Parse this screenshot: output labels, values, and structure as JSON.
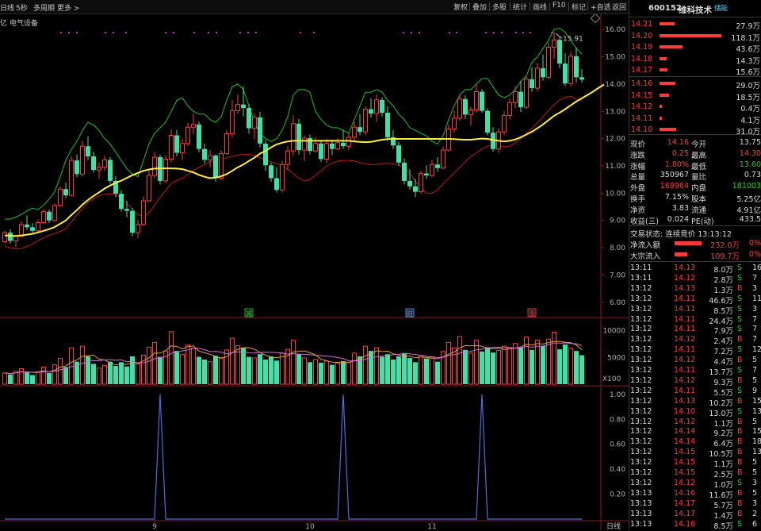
{
  "toolbar": {
    "left": [
      "日线",
      "5秒",
      "多周期",
      "更多 >"
    ],
    "right": [
      "复权",
      "叠加",
      "多股",
      "统计",
      "画线",
      "F10",
      "标记",
      "+自选",
      "返回"
    ]
  },
  "chart_info": {
    "sector": "亿 电气设备",
    "max_label": "15.91",
    "period_label": "日线",
    "vol_unit": "X100"
  },
  "price_axis": [
    "16.00",
    "15.00",
    "14.00",
    "13.00",
    "12.00",
    "11.00",
    "10.00",
    "9.00",
    "8.00",
    "7.00",
    "6.00"
  ],
  "vol_axis": [
    "10000",
    "5000"
  ],
  "ind_axis": [
    "1.00",
    "0.80",
    "0.60",
    "0.40",
    "0.20"
  ],
  "date_labels": [
    "9",
    "10",
    "11"
  ],
  "markers": [
    "减",
    "财",
    "涨"
  ],
  "colors": {
    "up": "#ff3b3b",
    "down": "#40e0a8",
    "ma": "#ffee33",
    "upper": "#22c022",
    "lower": "#c01818",
    "indicator": "#4a6fe0",
    "bg": "#000000"
  },
  "chart_data": {
    "type": "candlestick",
    "ylim": [
      5.5,
      16.5
    ],
    "candles": [
      [
        8.22,
        8.62,
        8.18,
        8.55
      ],
      [
        8.55,
        8.68,
        8.15,
        8.25
      ],
      [
        8.25,
        8.48,
        8.02,
        8.42
      ],
      [
        8.42,
        8.98,
        8.38,
        8.85
      ],
      [
        8.85,
        9.18,
        8.65,
        8.75
      ],
      [
        8.75,
        8.9,
        8.55,
        8.62
      ],
      [
        8.62,
        9.02,
        8.58,
        8.92
      ],
      [
        8.92,
        9.42,
        8.88,
        9.32
      ],
      [
        9.32,
        9.4,
        8.9,
        9.0
      ],
      [
        9.0,
        9.62,
        8.95,
        9.55
      ],
      [
        9.55,
        10.25,
        9.48,
        10.15
      ],
      [
        10.15,
        10.38,
        9.82,
        9.92
      ],
      [
        9.92,
        11.35,
        9.88,
        11.2
      ],
      [
        11.2,
        11.42,
        10.58,
        10.7
      ],
      [
        10.7,
        11.92,
        10.62,
        11.72
      ],
      [
        11.72,
        12.08,
        11.22,
        11.35
      ],
      [
        11.35,
        11.52,
        10.75,
        10.85
      ],
      [
        10.85,
        11.12,
        10.52,
        10.95
      ],
      [
        10.95,
        11.38,
        10.82,
        11.22
      ],
      [
        11.22,
        11.32,
        10.35,
        10.45
      ],
      [
        10.45,
        10.62,
        9.85,
        9.98
      ],
      [
        9.98,
        10.12,
        9.32,
        9.42
      ],
      [
        9.42,
        9.72,
        9.12,
        9.35
      ],
      [
        9.35,
        9.46,
        8.42,
        8.55
      ],
      [
        8.55,
        9.02,
        8.35,
        8.85
      ],
      [
        8.85,
        9.88,
        8.8,
        9.72
      ],
      [
        9.72,
        10.82,
        9.66,
        10.65
      ],
      [
        10.65,
        11.52,
        10.55,
        11.32
      ],
      [
        11.32,
        11.42,
        10.32,
        10.45
      ],
      [
        10.45,
        11.4,
        10.38,
        11.25
      ],
      [
        11.25,
        12.35,
        11.12,
        12.12
      ],
      [
        12.12,
        12.32,
        11.35,
        11.48
      ],
      [
        11.48,
        11.98,
        11.22,
        11.82
      ],
      [
        11.82,
        12.58,
        11.72,
        12.42
      ],
      [
        12.42,
        12.92,
        12.18,
        12.52
      ],
      [
        12.52,
        12.62,
        11.5,
        11.62
      ],
      [
        11.62,
        11.82,
        11.08,
        11.22
      ],
      [
        11.22,
        11.58,
        10.95,
        11.38
      ],
      [
        11.38,
        11.42,
        10.42,
        10.55
      ],
      [
        10.55,
        11.58,
        10.48,
        11.45
      ],
      [
        11.45,
        12.32,
        11.42,
        12.18
      ],
      [
        12.18,
        13.42,
        12.05,
        13.02
      ],
      [
        13.02,
        13.62,
        12.92,
        13.25
      ],
      [
        13.25,
        13.92,
        12.82,
        13.12
      ],
      [
        13.12,
        13.25,
        12.18,
        12.38
      ],
      [
        12.38,
        12.92,
        11.98,
        12.78
      ],
      [
        12.78,
        12.98,
        11.68,
        11.82
      ],
      [
        11.82,
        11.95,
        10.82,
        11.02
      ],
      [
        11.02,
        11.12,
        10.42,
        10.55
      ],
      [
        10.55,
        10.95,
        10.02,
        10.12
      ],
      [
        10.12,
        11.18,
        10.02,
        11.05
      ],
      [
        11.05,
        11.72,
        10.85,
        11.55
      ],
      [
        11.55,
        12.85,
        11.38,
        12.55
      ],
      [
        12.55,
        12.72,
        11.42,
        11.58
      ],
      [
        11.58,
        12.12,
        11.18,
        12.02
      ],
      [
        12.02,
        12.15,
        11.42,
        11.55
      ],
      [
        11.55,
        12.05,
        11.5,
        11.82
      ],
      [
        11.82,
        11.95,
        11.15,
        11.25
      ],
      [
        11.25,
        12.0,
        11.1,
        11.82
      ],
      [
        11.82,
        11.96,
        11.4,
        11.62
      ],
      [
        11.62,
        12.02,
        11.58,
        11.85
      ],
      [
        11.85,
        12.32,
        11.62,
        11.72
      ],
      [
        11.72,
        12.18,
        11.58,
        12.05
      ],
      [
        12.05,
        12.62,
        11.88,
        12.42
      ],
      [
        12.42,
        12.9,
        12.12,
        12.25
      ],
      [
        12.25,
        13.18,
        12.12,
        13.08
      ],
      [
        13.08,
        13.48,
        12.78,
        12.92
      ],
      [
        12.92,
        13.62,
        12.62,
        13.42
      ],
      [
        13.42,
        13.52,
        12.82,
        12.95
      ],
      [
        12.95,
        13.18,
        11.92,
        12.05
      ],
      [
        12.05,
        12.32,
        11.62,
        11.75
      ],
      [
        11.75,
        11.88,
        11.0,
        11.12
      ],
      [
        11.12,
        11.28,
        10.32,
        10.45
      ],
      [
        10.45,
        10.88,
        10.12,
        10.25
      ],
      [
        10.25,
        10.52,
        9.86,
        10.05
      ],
      [
        10.05,
        10.82,
        9.98,
        10.72
      ],
      [
        10.72,
        11.02,
        10.52,
        10.65
      ],
      [
        10.65,
        11.22,
        10.58,
        11.05
      ],
      [
        11.05,
        11.32,
        10.78,
        10.92
      ],
      [
        10.92,
        11.72,
        10.88,
        11.58
      ],
      [
        11.58,
        12.52,
        11.52,
        12.35
      ],
      [
        12.35,
        13.02,
        12.22,
        12.75
      ],
      [
        12.75,
        13.62,
        12.65,
        13.45
      ],
      [
        13.45,
        13.58,
        12.72,
        12.88
      ],
      [
        12.88,
        13.18,
        12.48,
        13.05
      ],
      [
        13.05,
        14.02,
        12.95,
        13.72
      ],
      [
        13.72,
        13.82,
        12.95,
        13.02
      ],
      [
        13.02,
        13.12,
        12.12,
        12.22
      ],
      [
        12.22,
        12.42,
        11.52,
        11.62
      ],
      [
        11.62,
        12.38,
        11.48,
        12.25
      ],
      [
        12.25,
        13.02,
        12.12,
        12.85
      ],
      [
        12.85,
        13.48,
        12.72,
        13.32
      ],
      [
        13.32,
        13.92,
        13.12,
        13.72
      ],
      [
        13.72,
        14.12,
        12.98,
        13.15
      ],
      [
        13.15,
        14.32,
        13.08,
        14.18
      ],
      [
        14.18,
        14.62,
        13.72,
        13.85
      ],
      [
        13.85,
        14.78,
        13.72,
        14.58
      ],
      [
        14.58,
        15.08,
        14.12,
        14.25
      ],
      [
        14.25,
        15.52,
        14.18,
        15.35
      ],
      [
        15.35,
        15.91,
        14.92,
        15.62
      ],
      [
        15.62,
        15.72,
        14.58,
        14.75
      ],
      [
        14.75,
        15.12,
        13.92,
        14.02
      ],
      [
        14.02,
        15.18,
        13.92,
        15.02
      ],
      [
        15.02,
        15.35,
        14.05,
        14.25
      ],
      [
        14.25,
        14.55,
        14.05,
        14.16
      ]
    ],
    "volume": [
      2100,
      1800,
      2400,
      2900,
      2200,
      1700,
      2300,
      3200,
      2100,
      3600,
      4800,
      3200,
      6800,
      4200,
      7100,
      5200,
      3800,
      3000,
      3500,
      4200,
      3400,
      4100,
      3300,
      5200,
      3800,
      5400,
      6900,
      7800,
      5100,
      6200,
      9800,
      6200,
      5600,
      7300,
      6700,
      5100,
      4600,
      4200,
      5300,
      5000,
      6400,
      8600,
      7200,
      6800,
      5100,
      4900,
      5600,
      4600,
      5200,
      4400,
      5800,
      6500,
      8200,
      5600,
      4900,
      4100,
      4600,
      4000,
      4300,
      3600,
      3900,
      4300,
      4100,
      5800,
      5200,
      7100,
      6200,
      6800,
      5100,
      5600,
      4600,
      5200,
      5800,
      4900,
      4100,
      5400,
      4800,
      5100,
      4200,
      6100,
      7800,
      6800,
      8900,
      6400,
      5800,
      8200,
      6100,
      6900,
      5900,
      6300,
      7100,
      6800,
      7600,
      6900,
      8800,
      6400,
      8200,
      7100,
      8400,
      9700,
      6500,
      7400,
      6700,
      6200,
      5400
    ],
    "ma": [
      8.45,
      8.44,
      8.43,
      8.45,
      8.48,
      8.51,
      8.56,
      8.62,
      8.68,
      8.76,
      8.88,
      9.0,
      9.2,
      9.38,
      9.58,
      9.75,
      9.9,
      10.03,
      10.17,
      10.28,
      10.38,
      10.46,
      10.56,
      10.66,
      10.74,
      10.82,
      10.87,
      10.9,
      10.91,
      10.91,
      10.91,
      10.9,
      10.88,
      10.82,
      10.76,
      10.67,
      10.6,
      10.55,
      10.57,
      10.62,
      10.7,
      10.82,
      10.95,
      11.05,
      11.18,
      11.3,
      11.45,
      11.55,
      11.68,
      11.79,
      11.85,
      11.9,
      11.92,
      11.92,
      11.92,
      11.92,
      11.92,
      11.92,
      11.92,
      11.92,
      11.92,
      11.92,
      11.92,
      11.9,
      11.88,
      11.87,
      11.88,
      11.92,
      11.96,
      11.98,
      11.99,
      11.99,
      11.99,
      11.99,
      11.99,
      11.99,
      11.99,
      11.99,
      11.99,
      11.99,
      11.99,
      11.98,
      11.97,
      11.96,
      11.96,
      11.98,
      12.0,
      11.99,
      11.95,
      11.92,
      11.9,
      11.92,
      11.97,
      12.05,
      12.15,
      12.25,
      12.38,
      12.52,
      12.68,
      12.84,
      12.95,
      13.08,
      13.22,
      13.36,
      13.48,
      13.6,
      13.72,
      13.86,
      13.98
    ],
    "upper": [
      9.05,
      9.05,
      9.12,
      9.22,
      9.35,
      9.45,
      9.4,
      9.55,
      9.78,
      10.05,
      10.6,
      11.2,
      11.6,
      11.9,
      12.3,
      12.6,
      12.5,
      12.3,
      12.0,
      11.8,
      11.5,
      11.2,
      10.9,
      10.7,
      10.6,
      11.2,
      11.8,
      12.2,
      12.4,
      12.6,
      13.0,
      13.4,
      13.5,
      13.2,
      13.0,
      12.9,
      12.9,
      12.7,
      12.6,
      12.8,
      13.4,
      13.9,
      14.0,
      13.8,
      13.2,
      12.6,
      12.2,
      12.0,
      11.9,
      12.0,
      12.3,
      12.8,
      13.6,
      13.8,
      13.8,
      13.7,
      13.0,
      12.7,
      12.5,
      12.4,
      12.4,
      12.3,
      12.2,
      12.7,
      13.2,
      13.7,
      13.7,
      13.8,
      13.7,
      13.4,
      13.2,
      12.9,
      12.7,
      12.4,
      12.3,
      12.2,
      12.1,
      11.9,
      11.8,
      12.1,
      12.7,
      13.2,
      13.6,
      13.8,
      13.8,
      14.0,
      14.2,
      14.2,
      13.9,
      13.6,
      13.5,
      13.6,
      13.8,
      14.1,
      14.3,
      14.8,
      15.0,
      15.3,
      15.6,
      16.0,
      16.05,
      15.9,
      15.6,
      15.3,
      15.1
    ],
    "lower": [
      8.05,
      8.0,
      7.96,
      7.97,
      8.05,
      8.14,
      8.25,
      8.37,
      8.46,
      8.52,
      8.6,
      8.7,
      8.95,
      9.2,
      9.45,
      9.65,
      9.8,
      9.9,
      9.96,
      9.98,
      9.95,
      9.82,
      9.62,
      9.42,
      9.22,
      9.15,
      9.28,
      9.55,
      9.85,
      10.1,
      10.35,
      10.48,
      10.55,
      10.68,
      10.82,
      10.95,
      11.05,
      11.15,
      11.2,
      11.25,
      11.3,
      11.35,
      11.4,
      11.42,
      11.42,
      11.38,
      11.3,
      11.22,
      11.15,
      11.08,
      11.0,
      10.88,
      10.72,
      10.55,
      10.45,
      10.5,
      10.65,
      10.82,
      11.0,
      11.1,
      11.18,
      11.2,
      11.2,
      11.18,
      11.12,
      11.08,
      11.05,
      11.05,
      11.08,
      11.1,
      11.08,
      11.02,
      10.92,
      10.72,
      10.45,
      10.2,
      10.0,
      10.0,
      10.12,
      10.35,
      10.55,
      10.75,
      10.95,
      11.15,
      11.35,
      11.48,
      11.62,
      11.72,
      11.78,
      11.75,
      11.7,
      11.72,
      11.85,
      12.0,
      12.18,
      12.38,
      12.58,
      12.8,
      13.02,
      13.25,
      13.42,
      13.52,
      13.55,
      13.45,
      13.4
    ],
    "indicator": {
      "ylim": [
        0,
        1.05
      ],
      "peaks_at": [
        28,
        61,
        86
      ]
    }
  },
  "stock": {
    "code": "600152",
    "name": "维科技术",
    "tag": "储能"
  },
  "asks": [
    {
      "label": "14.21",
      "vol": "27.9万",
      "bar": 0.24
    },
    {
      "label": "14.20",
      "vol": "118.1万",
      "bar": 1.0
    },
    {
      "label": "14.19",
      "vol": "43.6万",
      "bar": 0.37
    },
    {
      "label": "14.18",
      "vol": "14.3万",
      "bar": 0.12
    },
    {
      "label": "14.17",
      "vol": "15.6万",
      "bar": 0.13
    }
  ],
  "bids": [
    {
      "label": "14.16",
      "vol": "29.0万",
      "bar": 0.25
    },
    {
      "label": "14.15",
      "vol": "18.5万",
      "bar": 0.16
    },
    {
      "label": "14.12",
      "vol": "0.4万",
      "bar": 0.02
    },
    {
      "label": "14.11",
      "vol": "4.1万",
      "bar": 0.04
    },
    {
      "label": "14.10",
      "vol": "31.0万",
      "bar": 0.27
    }
  ],
  "stats": [
    {
      "l1": "现价",
      "v1": "14.16",
      "c1": "red",
      "l2": "今开",
      "v2": "13.75",
      "c2": "white"
    },
    {
      "l1": "涨跌",
      "v1": "0.25",
      "c1": "red",
      "l2": "最高",
      "v2": "14.30",
      "c2": "red"
    },
    {
      "l1": "涨幅",
      "v1": "1.80%",
      "c1": "red",
      "l2": "最低",
      "v2": "13.60",
      "c2": "green"
    },
    {
      "l1": "总量",
      "v1": "350967",
      "c1": "white",
      "l2": "量比",
      "v2": "0.73",
      "c2": "white"
    },
    {
      "l1": "外盘",
      "v1": "169964",
      "c1": "red",
      "l2": "内盘",
      "v2": "181003",
      "c2": "green"
    },
    {
      "l1": "换手",
      "v1": "7.15%",
      "c1": "white",
      "l2": "股本",
      "v2": "5.25亿",
      "c2": "white"
    },
    {
      "l1": "净资",
      "v1": "3.83",
      "c1": "white",
      "l2": "流通",
      "v2": "4.91亿",
      "c2": "white"
    },
    {
      "l1": "收益(三)",
      "v1": "0.024",
      "c1": "white",
      "l2": "PE(动)",
      "v2": "433.5",
      "c2": "white"
    }
  ],
  "trade_status": "交易状态: 连续竞价 13:13:12",
  "flows": [
    {
      "label": "净流入额",
      "value": "232.0万",
      "pct": "0%",
      "bar": 1.0
    },
    {
      "label": "大宗流入",
      "value": "109.7万",
      "pct": "0%",
      "bar": 0.47
    }
  ],
  "ticks": [
    {
      "t": "13:11",
      "p": "14.13",
      "v": "8.0万",
      "d": "S",
      "n": "16"
    },
    {
      "t": "13:11",
      "p": "14.12",
      "v": "2.8万",
      "d": "S",
      "n": "7"
    },
    {
      "t": "13:12",
      "p": "14.13",
      "v": "1.3万",
      "d": "B",
      "n": "3"
    },
    {
      "t": "13:12",
      "p": "14.11",
      "v": "46.6万",
      "d": "S",
      "n": "11"
    },
    {
      "t": "13:12",
      "p": "14.11",
      "v": "8.5万",
      "d": "S",
      "n": "3"
    },
    {
      "t": "13:12",
      "p": "14.11",
      "v": "24.4万",
      "d": "S",
      "n": "7"
    },
    {
      "t": "13:12",
      "p": "14.11",
      "v": "7.9万",
      "d": "S",
      "n": "7"
    },
    {
      "t": "13:12",
      "p": "14.12",
      "v": "2.4万",
      "d": "B",
      "n": "7"
    },
    {
      "t": "13:12",
      "p": "14.11",
      "v": "7.2万",
      "d": "S",
      "n": "12"
    },
    {
      "t": "13:12",
      "p": "14.12",
      "v": "4.4万",
      "d": "B",
      "n": "5"
    },
    {
      "t": "13:12",
      "p": "14.11",
      "v": "13.7万",
      "d": "S",
      "n": "7"
    },
    {
      "t": "13:12",
      "p": "14.12",
      "v": "9.3万",
      "d": "B",
      "n": "5"
    },
    {
      "t": "13:12",
      "p": "14.11",
      "v": "5.5万",
      "d": "S",
      "n": "9"
    },
    {
      "t": "13:12",
      "p": "14.13",
      "v": "10.2万",
      "d": "B",
      "n": "15"
    },
    {
      "t": "13:12",
      "p": "14.10",
      "v": "13.0万",
      "d": "S",
      "n": "13"
    },
    {
      "t": "13:12",
      "p": "14.12",
      "v": "1.1万",
      "d": "B",
      "n": "5"
    },
    {
      "t": "13:12",
      "p": "14.14",
      "v": "9.2万",
      "d": "B",
      "n": "15"
    },
    {
      "t": "13:12",
      "p": "14.14",
      "v": "6.4万",
      "d": "B",
      "n": "18"
    },
    {
      "t": "13:12",
      "p": "14.15",
      "v": "10.5万",
      "d": "B",
      "n": "13"
    },
    {
      "t": "13:12",
      "p": "14.15",
      "v": "1.1万",
      "d": "B",
      "n": "5"
    },
    {
      "t": "13:12",
      "p": "14.15",
      "v": "2.5万",
      "d": "B",
      "n": "5"
    },
    {
      "t": "13:12",
      "p": "14.12",
      "v": "1.0万",
      "d": "S",
      "n": "3"
    },
    {
      "t": "13:13",
      "p": "14.16",
      "v": "11.6万",
      "d": "B",
      "n": "5"
    },
    {
      "t": "13:13",
      "p": "14.17",
      "v": "5.7万",
      "d": "B",
      "n": "3"
    },
    {
      "t": "13:13",
      "p": "14.17",
      "v": "1.4万",
      "d": "B",
      "n": "2"
    },
    {
      "t": "13:13",
      "p": "14.16",
      "v": "8.5万",
      "d": "S",
      "n": "6"
    }
  ]
}
